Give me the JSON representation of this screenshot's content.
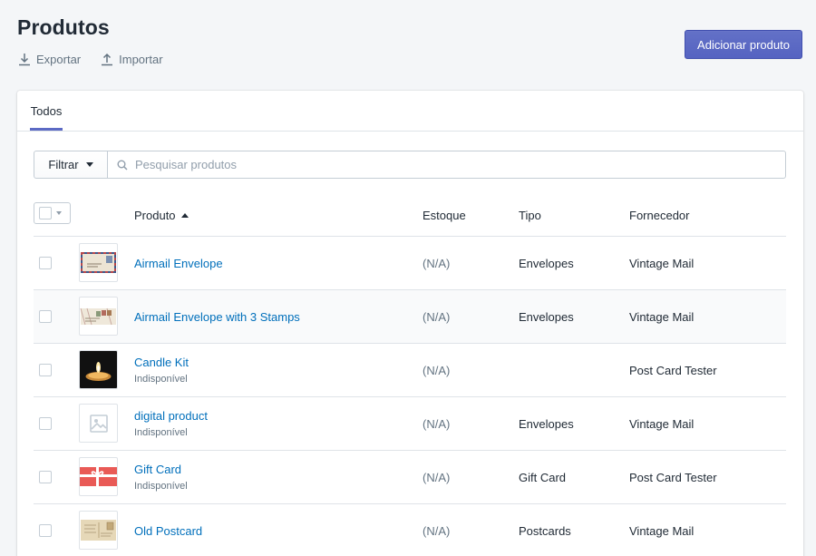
{
  "page": {
    "title": "Produtos",
    "actions": [
      {
        "label": "Exportar",
        "icon": "export-icon"
      },
      {
        "label": "Importar",
        "icon": "import-icon"
      }
    ],
    "primary_button": "Adicionar produto"
  },
  "tabs": [
    {
      "label": "Todos",
      "selected": true
    }
  ],
  "filter": {
    "button_label": "Filtrar",
    "search_placeholder": "Pesquisar produtos"
  },
  "table": {
    "columns": [
      "Produto",
      "Estoque",
      "Tipo",
      "Fornecedor"
    ],
    "sort_column": "Produto",
    "sort_direction": "ascending",
    "rows": [
      {
        "name": "Airmail Envelope",
        "status": "",
        "stock": "(N/A)",
        "type": "Envelopes",
        "vendor": "Vintage Mail",
        "thumb": "airmail-envelope"
      },
      {
        "name": "Airmail Envelope with 3 Stamps",
        "status": "",
        "stock": "(N/A)",
        "type": "Envelopes",
        "vendor": "Vintage Mail",
        "thumb": "airmail-envelope-stamps"
      },
      {
        "name": "Candle Kit",
        "status": "Indisponível",
        "stock": "(N/A)",
        "type": "",
        "vendor": "Post Card Tester",
        "thumb": "candle"
      },
      {
        "name": "digital product",
        "status": "Indisponível",
        "stock": "(N/A)",
        "type": "Envelopes",
        "vendor": "Vintage Mail",
        "thumb": "placeholder-image"
      },
      {
        "name": "Gift Card",
        "status": "Indisponível",
        "stock": "(N/A)",
        "type": "Gift Card",
        "vendor": "Post Card Tester",
        "thumb": "gift-card"
      },
      {
        "name": "Old Postcard",
        "status": "",
        "stock": "(N/A)",
        "type": "Postcards",
        "vendor": "Vintage Mail",
        "thumb": "old-postcard"
      }
    ]
  },
  "colors": {
    "primary": "#5c6ac4",
    "link": "#006fbb",
    "muted": "#637381",
    "background": "#f4f6f8"
  }
}
